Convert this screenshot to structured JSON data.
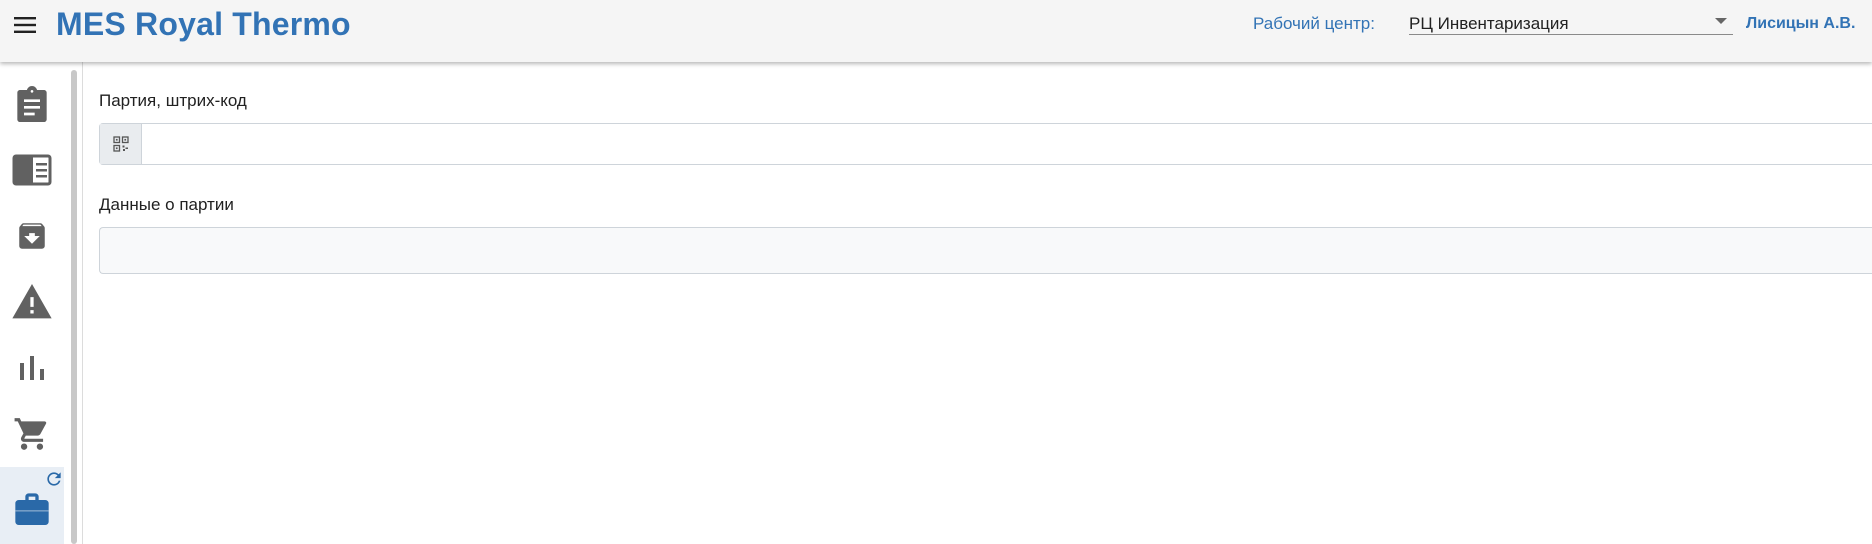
{
  "header": {
    "title": "MES Royal Thermo",
    "work_center_label": "Рабочий центр:",
    "work_center_value": "РЦ Инвентаризация",
    "user": "Лисицын А.В."
  },
  "sidebar": {
    "items": [
      {
        "icon": "clipboard-icon",
        "active": false
      },
      {
        "icon": "panel-list-icon",
        "active": false
      },
      {
        "icon": "archive-download-icon",
        "active": false
      },
      {
        "icon": "warning-icon",
        "active": false
      },
      {
        "icon": "bar-chart-icon",
        "active": false
      },
      {
        "icon": "cart-icon",
        "active": false
      },
      {
        "icon": "briefcase-icon",
        "active": true,
        "badge": "refresh-icon"
      }
    ]
  },
  "form": {
    "barcode_label": "Партия, штрих-код",
    "barcode_value": "",
    "barcode_placeholder": "",
    "batch_info_label": "Данные о партии",
    "batch_info_value": ""
  },
  "colors": {
    "accent": "#3273b5",
    "icon": "#616161",
    "active_icon": "#2a69a8",
    "appbar_bg": "#f5f5f5"
  }
}
